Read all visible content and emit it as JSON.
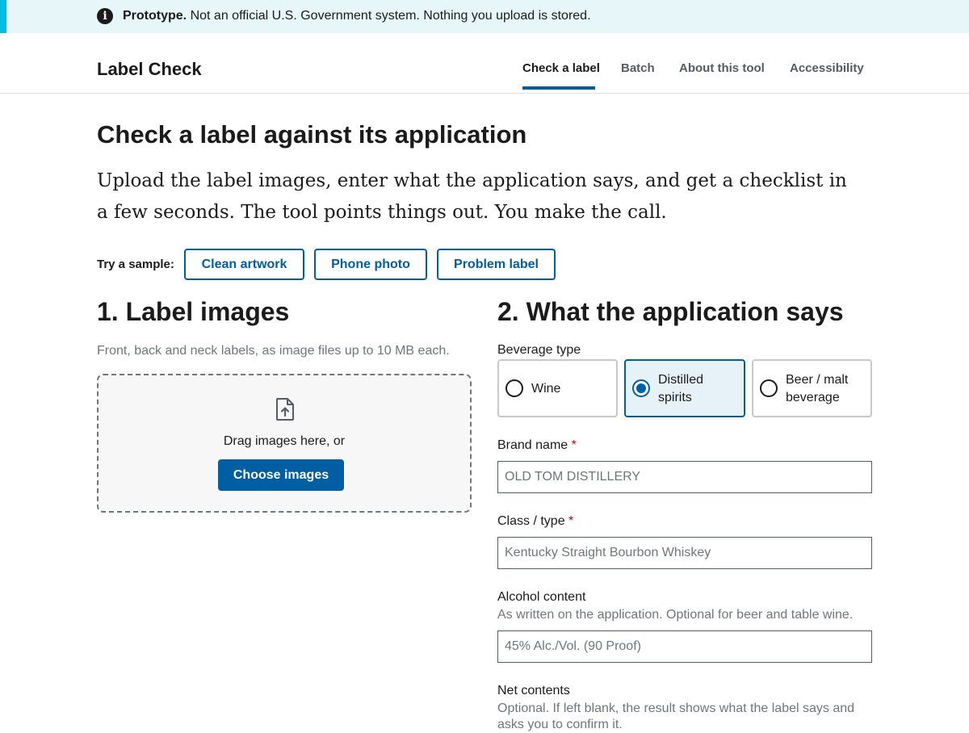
{
  "banner": {
    "icon": "info-icon",
    "strong": "Prototype.",
    "text": "Not an official U.S. Government system. Nothing you upload is stored."
  },
  "header": {
    "title": "Label Check",
    "nav": [
      {
        "label": "Check a label",
        "current": true
      },
      {
        "label": "Batch",
        "current": false
      },
      {
        "label": "About this tool",
        "current": false
      },
      {
        "label": "Accessibility",
        "current": false
      }
    ]
  },
  "main": {
    "heading": "Check a label against its application",
    "lead": "Upload the label images, enter what the application says, and get a checklist in a few seconds. The tool points things out. You make the call.",
    "samples": {
      "label": "Try a sample:",
      "buttons": [
        "Clean artwork",
        "Phone photo",
        "Problem label"
      ]
    }
  },
  "images_section": {
    "heading": "1. Label images",
    "hint": "Front, back and neck labels, as image files up to 10 MB each.",
    "dropzone": {
      "icon": "file-upload-icon",
      "text": "Drag images here, or",
      "button": "Choose images"
    }
  },
  "application_section": {
    "heading": "2. What the application says",
    "beverage_type": {
      "label": "Beverage type",
      "options": [
        "Wine",
        "Distilled spirits",
        "Beer / malt beverage"
      ],
      "selected": "Distilled spirits"
    },
    "brand_name": {
      "label": "Brand name",
      "required_mark": "*",
      "placeholder": "OLD TOM DISTILLERY"
    },
    "class_type": {
      "label": "Class / type",
      "required_mark": "*",
      "placeholder": "Kentucky Straight Bourbon Whiskey"
    },
    "alcohol_content": {
      "label": "Alcohol content",
      "hint": "As written on the application. Optional for beer and table wine.",
      "placeholder": "45% Alc./Vol. (90 Proof)"
    },
    "net_contents": {
      "label": "Net contents",
      "hint": "Optional. If left blank, the result shows what the label says and asks you to confirm it."
    }
  },
  "colors": {
    "primary": "#005ea2",
    "banner_bg": "#e7f6f8",
    "banner_accent": "#00bde3",
    "required": "#b50909"
  }
}
